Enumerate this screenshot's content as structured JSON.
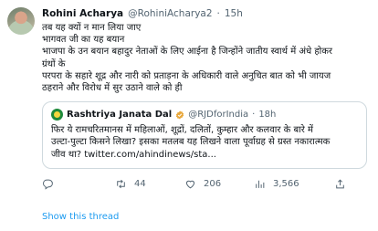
{
  "tweet": {
    "author_name": "Rohini Acharya",
    "author_handle": "@RohiniAcharya2",
    "separator": "·",
    "time": "15h",
    "text_lines": [
      "तब यह क्यों न मान लिया जाए",
      "भागवत जी का यह बयान",
      "भाजपा के उन बयान बहादुर नेताओं के लिए आईना है जिन्होंने जातीय स्वार्थ में अंधे होकर",
      "ग्रंथों के",
      "परपरा के सहारे शूद्र और नारी को प्रताड़ना के अधिकारी वाले अनुचित बात को भी जायज",
      "ठहराने और विरोध में सुर उठाने वाले को ही"
    ]
  },
  "quoted": {
    "name": "Rashtriya Janata Dal",
    "handle": "@RJDforIndia",
    "separator": "·",
    "time": "18h",
    "text_lines": [
      "फिर ये रामचरितमानस में महिलाओं, शूद्रों, दलितों, कुम्हार और कलवार के बारे में",
      "उल्टा-पुल्टा किसने लिखा? इसका मतलब यह लिखने वाला पूर्वाग्रह से ग्रस्त नकारात्मक",
      "जीव था? twitter.com/ahindinews/sta..."
    ]
  },
  "actions": {
    "reply_count": "",
    "retweet_count": "44",
    "like_count": "206",
    "views_count": "3,566"
  },
  "icons": {
    "reply": "reply-icon",
    "retweet": "retweet-icon",
    "like": "heart-icon",
    "views": "views-icon",
    "verified": "verified-badge-icon"
  },
  "colors": {
    "link": "#1d9bf0",
    "secondary_text": "#536471",
    "verified_gold": "#e8a73a"
  },
  "show_thread_label": "Show this thread"
}
